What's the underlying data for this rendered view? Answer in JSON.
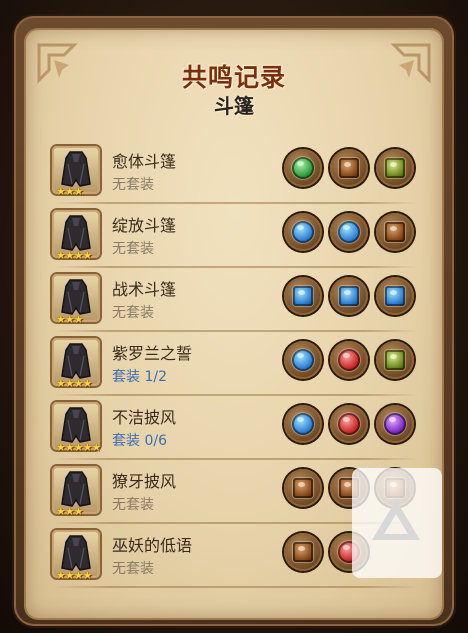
{
  "panel": {
    "title": "共鸣记录",
    "subtitle": "斗篷"
  },
  "items": [
    {
      "name": "愈体斗篷",
      "set": "无套装",
      "set_active": false,
      "stars": 3,
      "gems": [
        "green",
        "brown",
        "olive"
      ]
    },
    {
      "name": "绽放斗篷",
      "set": "无套装",
      "set_active": false,
      "stars": 4,
      "gems": [
        "blue",
        "blue",
        "brown"
      ]
    },
    {
      "name": "战术斗篷",
      "set": "无套装",
      "set_active": false,
      "stars": 3,
      "gems": [
        "blue",
        "blue",
        "blue"
      ]
    },
    {
      "name": "紫罗兰之誓",
      "set": "套装 1/2",
      "set_active": true,
      "stars": 4,
      "gems": [
        "blue",
        "red",
        "olive"
      ]
    },
    {
      "name": "不洁披风",
      "set": "套装 0/6",
      "set_active": true,
      "stars": 5,
      "gems": [
        "blue",
        "red",
        "purple"
      ]
    },
    {
      "name": "獠牙披风",
      "set": "无套装",
      "set_active": false,
      "stars": 3,
      "gems": [
        "brown",
        "brown",
        "brown"
      ]
    },
    {
      "name": "巫妖的低语",
      "set": "无套装",
      "set_active": false,
      "stars": 4,
      "gems": [
        "brown",
        "red",
        ""
      ]
    }
  ],
  "star_glyph": "★",
  "colors": {
    "title": "#7a2e0e",
    "set_active": "#3a6fb0",
    "set_inactive": "#8a7a66"
  }
}
